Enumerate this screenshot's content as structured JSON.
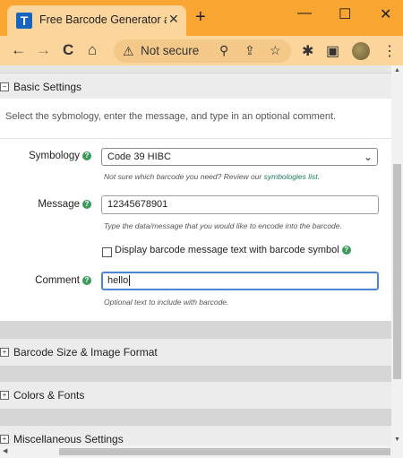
{
  "browser": {
    "tab_title": "Free Barcode Generator and B",
    "tab_favicon": "T",
    "tab_close": "✕",
    "new_tab": "+",
    "window": {
      "minimize": "—",
      "maximize": "☐",
      "close": "✕"
    },
    "url_text": "Not secure",
    "nav": {
      "back": "←",
      "forward": "→",
      "reload": "C",
      "home": "⌂"
    },
    "toolbar_icons": {
      "zoom": "⚲",
      "share": "⇪",
      "bookmark": "☆",
      "extensions": "✱",
      "sidepanel": "▣",
      "menu": "⋮"
    }
  },
  "sections": [
    {
      "title": "Basic Settings",
      "toggle": "⊟"
    },
    {
      "title": "Barcode Size & Image Format",
      "toggle": "⊞"
    },
    {
      "title": "Colors & Fonts",
      "toggle": "⊞"
    },
    {
      "title": "Miscellaneous Settings",
      "toggle": "⊞"
    }
  ],
  "basic": {
    "intro": "Select the sybmology, enter the message, and type in an optional comment.",
    "symbology": {
      "label": "Symbology",
      "value": "Code 39 HIBC",
      "hint_prefix": "Not sure which barcode you need? Review our ",
      "hint_link": "symbologies list",
      "hint_suffix": "."
    },
    "message": {
      "label": "Message",
      "value": "12345678901",
      "hint": "Type the data/message that you would like to encode into the barcode."
    },
    "display_text": {
      "label": "Display barcode message text with barcode symbol",
      "checked": false
    },
    "comment": {
      "label": "Comment",
      "value": "hello",
      "hint": "Optional text to include with barcode."
    },
    "help_glyph": "?"
  },
  "colors": {
    "accent": "#f8a532",
    "help_icon": "#3a9a5a",
    "link": "#1a7a5a",
    "focus": "#4a86d4"
  }
}
